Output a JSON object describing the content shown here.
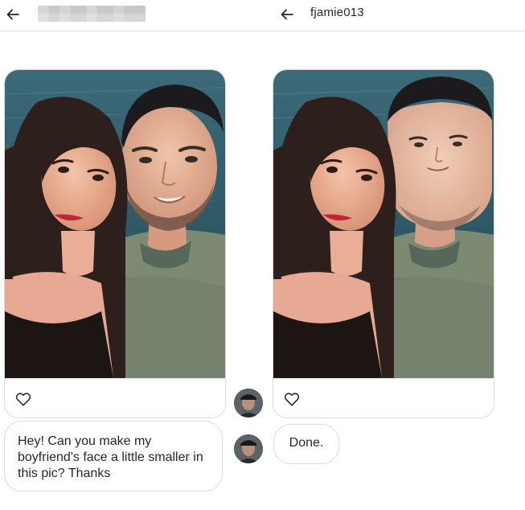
{
  "left_panel": {
    "header": {
      "back_icon": "arrow-left-icon",
      "name": ""
    },
    "photo_message": {
      "like_icon": "heart-outline-icon"
    },
    "text_message": "Hey! Can you make my boyfriend's face a little smaller in this pic? Thanks"
  },
  "right_panel": {
    "header": {
      "back_icon": "arrow-left-icon",
      "username": "fjamie013"
    },
    "photo_message": {
      "like_icon": "heart-outline-icon"
    },
    "reply_message": "Done."
  },
  "colors": {
    "border": "#dbdbdb",
    "text": "#262626",
    "background": "#ffffff"
  }
}
